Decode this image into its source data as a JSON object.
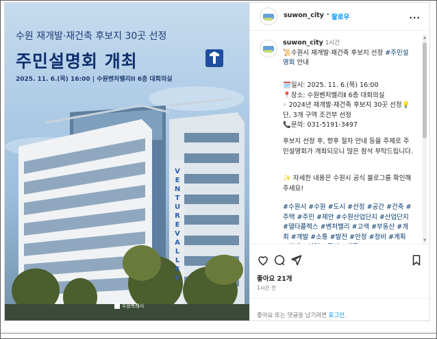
{
  "image": {
    "headline": "수원 재개발·재건축 후보지 30곳 선정",
    "title": "주민설명회 개최",
    "dateline": "2025. 11. 6.(목) 16:00 | 수원벤처밸리II 6층 대회의실",
    "building_sign": "VENTURE VALLEY",
    "footer_logo": "수원특례시"
  },
  "header": {
    "username": "suwon_city",
    "separator": "•",
    "follow_label": "팔로우",
    "more_label": "..."
  },
  "caption": {
    "username": "suwon_city",
    "time": "1시간",
    "line1_prefix": "📜수원시 재개발·재건축 후보지 선정 ",
    "line1_tag": "#주민설명회",
    "line1_suffix": " 안내",
    "date_line": "🗓️일시: 2025. 11. 6.(목) 16:00",
    "place_line": "📍장소: 수원벤처밸리Ⅱ 6층 대회의실",
    "note_line": "◦ 2024년 재개발·재건축 후보지 30곳 선정💡단, 3개 구역 조건부 선정",
    "contact_line": "📞문의: 031-5191-3497",
    "body": "후보지 선정 후, 향후 절차 안내 등을 주제로 주민설명회가 개최되오니 많은 참석 부탁드립니다.",
    "more_info": "✨ 자세한 내용은 수원시 공식 블로그를 확인해 주세요!",
    "hashtags": "#수원시 #수원 #도시 #선정 #공간 #건축 #주택 #주민 #제안 #수원산업단지 #산업단지 #델타플렉스 #벤처밸리 #고색 #부동산 #개최 #개발 #소통 #발전 #안정 #정비 #계획 #안내 #설명 #주거 #생활"
  },
  "actions": {
    "likes": "좋아요 21개",
    "time_ago": "1시간 전"
  },
  "comment": {
    "prompt": "좋아요 또는 댓글을 남기려면 ",
    "login_link": "로그인."
  }
}
